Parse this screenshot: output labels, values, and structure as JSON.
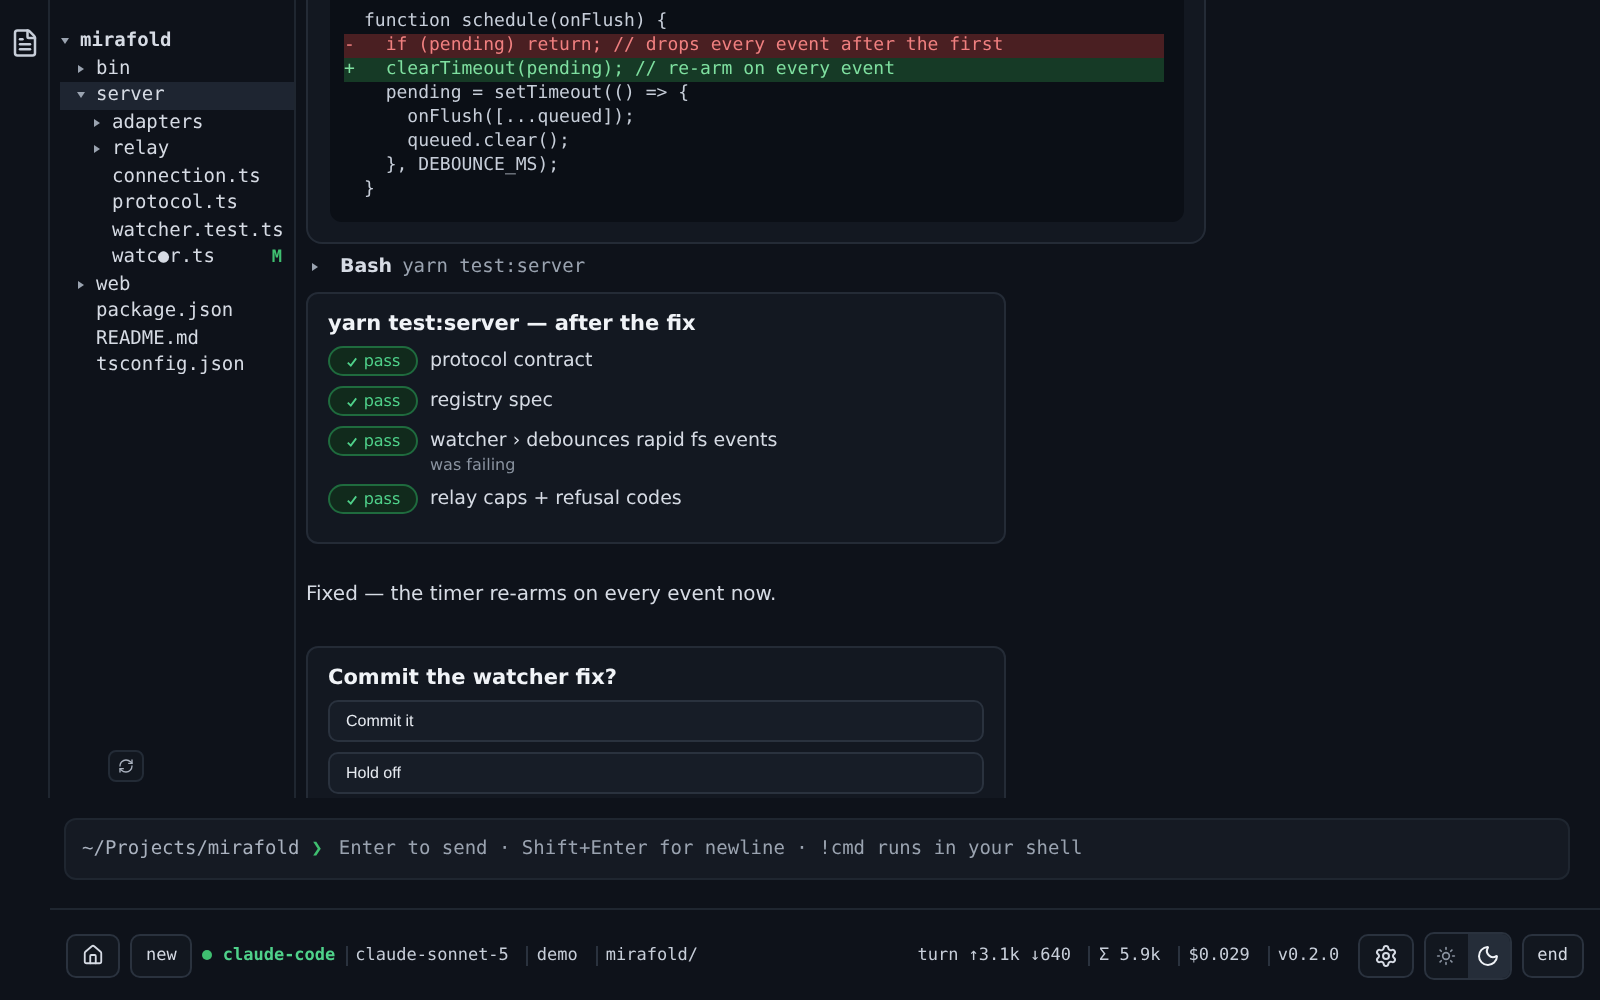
{
  "sidebar": {
    "tree": [
      {
        "name": "mirafold",
        "kind": "folder",
        "expanded": true,
        "selected": false,
        "children": [
          {
            "name": "bin",
            "kind": "folder",
            "expanded": false,
            "selected": false
          },
          {
            "name": "server",
            "kind": "folder",
            "expanded": true,
            "selected": true,
            "children": [
              {
                "name": "adapters",
                "kind": "folder",
                "expanded": false,
                "selected": false
              },
              {
                "name": "relay",
                "kind": "folder",
                "expanded": false,
                "selected": false
              },
              {
                "name": "connection.ts",
                "kind": "file",
                "selected": false
              },
              {
                "name": "protocol.ts",
                "kind": "file",
                "selected": false
              },
              {
                "name": "watcher.test.ts",
                "kind": "file",
                "selected": false
              },
              {
                "name": "watc●r.ts",
                "kind": "file",
                "selected": false,
                "badge": "M"
              }
            ]
          },
          {
            "name": "web",
            "kind": "folder",
            "expanded": false,
            "selected": false
          },
          {
            "name": "package.json",
            "kind": "file",
            "selected": false
          },
          {
            "name": "README.md",
            "kind": "file",
            "selected": false
          },
          {
            "name": "tsconfig.json",
            "kind": "file",
            "selected": false
          }
        ]
      }
    ]
  },
  "diff": {
    "lines": [
      {
        "kind": "context",
        "text": "function schedule(onFlush) {"
      },
      {
        "kind": "removed",
        "sign": "-",
        "text": "  if (pending) return; // drops every event after the first"
      },
      {
        "kind": "added",
        "sign": "+",
        "text": "  clearTimeout(pending); // re-arm on every event"
      },
      {
        "kind": "context",
        "text": "  pending = setTimeout(() => {"
      },
      {
        "kind": "context",
        "text": "    onFlush([...queued]);"
      },
      {
        "kind": "context",
        "text": "    queued.clear();"
      },
      {
        "kind": "context",
        "text": "  }, DEBOUNCE_MS);"
      },
      {
        "kind": "context",
        "text": "}"
      }
    ]
  },
  "tool_call": {
    "tool": "Bash",
    "command": "yarn test:server",
    "expanded": false
  },
  "test_results": {
    "title": "yarn test:server — after the fix",
    "tests": [
      {
        "status": "pass",
        "name": "protocol contract"
      },
      {
        "status": "pass",
        "name": "registry spec"
      },
      {
        "status": "pass",
        "name": "watcher › debounces rapid fs events",
        "note": "was failing"
      },
      {
        "status": "pass",
        "name": "relay caps + refusal codes"
      }
    ]
  },
  "message": "Fixed — the timer re-arms on every event now.",
  "question": {
    "title": "Commit the watcher fix?",
    "options": [
      "Commit it",
      "Hold off"
    ]
  },
  "prompt": {
    "path": "~/Projects/mirafold",
    "symbol": "❯",
    "placeholder": "Enter to send · Shift+Enter for newline · !cmd runs in your shell"
  },
  "status_bar": {
    "new_label": "new",
    "agent": "claude-code",
    "connected": true,
    "model": "claude-sonnet-5",
    "mode": "demo",
    "folder": "mirafold/",
    "turn": "turn ↑3.1k ↓640",
    "total": "Σ 5.9k",
    "cost": "$0.029",
    "version": "v0.2.0",
    "dark_mode": true,
    "end_label": "end"
  }
}
